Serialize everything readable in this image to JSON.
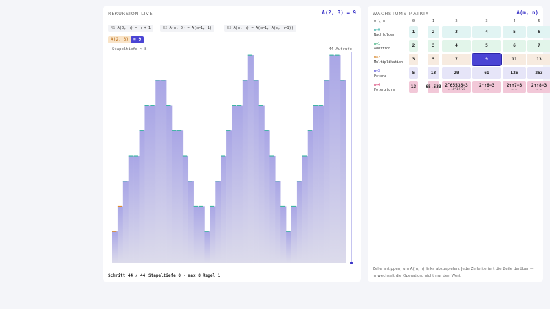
{
  "left": {
    "header": "REKURSION LIVE",
    "result": "A(2, 3) = 9",
    "rules": [
      {
        "id": "R1",
        "text": "A(0, n) = n + 1"
      },
      {
        "id": "R2",
        "text": "A(m, 0) = A(m−1, 1)"
      },
      {
        "id": "R3",
        "text": "A(m, n) = A(m−1, A(m, n−1))"
      }
    ],
    "call_chip": "A(2, 3)",
    "result_chip": "= 9",
    "plot_label_left": "Stapeltiefe ≈ 8",
    "plot_label_right": "44 Aufrufe",
    "footer": {
      "step": "Schritt 44 / 44",
      "depth": "Stapeltiefe 0 · max 8",
      "rule": "Regel 1"
    }
  },
  "chart_data": {
    "type": "area",
    "x_count": 44,
    "values": [
      1,
      2,
      3,
      4,
      4,
      5,
      6,
      6,
      7,
      7,
      6,
      5,
      5,
      4,
      3,
      2,
      2,
      1,
      2,
      3,
      4,
      5,
      6,
      6,
      7,
      8,
      7,
      6,
      5,
      4,
      3,
      2,
      1,
      2,
      3,
      4,
      5,
      6,
      6,
      7,
      8,
      8,
      7,
      0
    ],
    "ymax": 8,
    "colors": {
      "fill_top": "#a9a6e6",
      "fill_bottom": "#dcdbeb",
      "cap_rule1": "#3fb5a3",
      "cap_rule2": "#e08a2c",
      "cap_rule3": "#5a6fd0"
    }
  },
  "right": {
    "header": "WACHSTUMS-MATRIX",
    "label": "A(m, n)",
    "corner": "m \\ n",
    "columns": [
      "0",
      "1",
      "2",
      "3",
      "4",
      "5"
    ],
    "rows": [
      {
        "code": "m=0",
        "name": "Nachfolger",
        "color": "#2aa8a0",
        "bg": "#e1f4f3",
        "cells": [
          {
            "v": "1"
          },
          {
            "v": "2"
          },
          {
            "v": "3"
          },
          {
            "v": "4"
          },
          {
            "v": "5"
          },
          {
            "v": "6"
          }
        ]
      },
      {
        "code": "m=1",
        "name": "Addition",
        "color": "#2aa870",
        "bg": "#e2f5ea",
        "cells": [
          {
            "v": "2"
          },
          {
            "v": "3"
          },
          {
            "v": "4"
          },
          {
            "v": "5"
          },
          {
            "v": "6"
          },
          {
            "v": "7"
          }
        ]
      },
      {
        "code": "m=2",
        "name": "Multiplikation",
        "color": "#d47f1c",
        "bg": "#f7ebe0",
        "cells": [
          {
            "v": "3"
          },
          {
            "v": "5"
          },
          {
            "v": "7"
          },
          {
            "v": "9"
          },
          {
            "v": "11"
          },
          {
            "v": "13"
          }
        ]
      },
      {
        "code": "m=3",
        "name": "Potenz",
        "color": "#4a44d4",
        "bg": "#e6e5f8",
        "cells": [
          {
            "v": "5"
          },
          {
            "v": "13"
          },
          {
            "v": "29"
          },
          {
            "v": "61"
          },
          {
            "v": "125"
          },
          {
            "v": "253"
          }
        ]
      },
      {
        "code": "m=4",
        "name": "Potenzturm",
        "color": "#d43a6e",
        "bg": "#f2c8d8",
        "cells": [
          {
            "v": "13"
          },
          {
            "v": "65.533"
          },
          {
            "v": "2^65536−3",
            "sub": "≈ 10^19728"
          },
          {
            "v": "2↑↑6−3",
            "sub": "≈ ∞"
          },
          {
            "v": "2↑↑7−3",
            "sub": "≈ ∞"
          },
          {
            "v": "2↑↑8−3",
            "sub": "≈ ∞"
          }
        ]
      }
    ],
    "help": "Zelle antippen, um A(m, n) links abzuspielen. Jede Zeile iteriert die Zeile darüber — m wechselt die Operation, nicht nur den Wert."
  }
}
